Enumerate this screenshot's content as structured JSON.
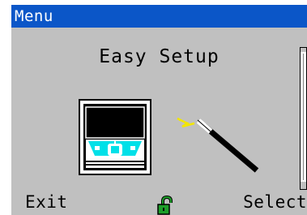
{
  "menu": {
    "title": "Menu"
  },
  "main": {
    "heading": "Easy Setup",
    "illustration": {
      "icons": [
        "recorder-device-icon",
        "magic-wand-icon"
      ]
    }
  },
  "softkeys": {
    "left_label": "Exit",
    "right_label": "Select",
    "center_icon": "unlocked-padlock-icon"
  },
  "colors": {
    "title_bar": "#0b56c8",
    "title_text": "#ffffff",
    "background": "#c0c0c0",
    "lock": "#1e9e2a",
    "wand_spark": "#f2e600",
    "device_accent": "#00e0e8"
  }
}
